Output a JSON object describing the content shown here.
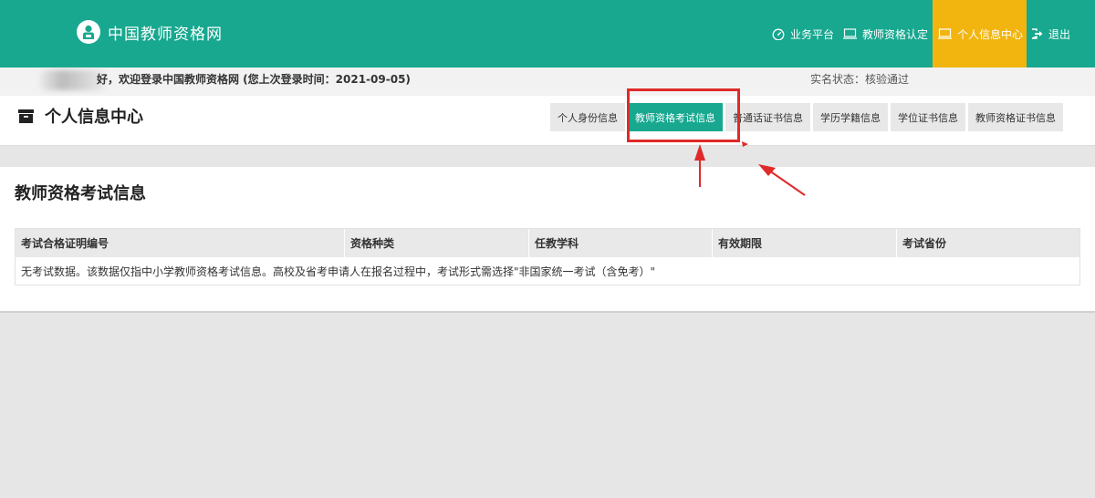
{
  "header": {
    "site_title": "中国教师资格网",
    "nav": [
      {
        "label": "业务平台",
        "icon": "dashboard-icon"
      },
      {
        "label": "教师资格认定",
        "icon": "monitor-icon"
      },
      {
        "label": "个人信息中心",
        "icon": "laptop-icon",
        "active": true
      },
      {
        "label": "退出",
        "icon": "logout-icon"
      }
    ]
  },
  "welcome": {
    "text": "好，欢迎登录中国教师资格网 (您上次登录时间：2021-09-05)",
    "realname_status": "实名状态：核验通过"
  },
  "center": {
    "title": "个人信息中心",
    "tabs": [
      {
        "label": "个人身份信息"
      },
      {
        "label": "教师资格考试信息",
        "active": true
      },
      {
        "label": "普通话证书信息"
      },
      {
        "label": "学历学籍信息"
      },
      {
        "label": "学位证书信息"
      },
      {
        "label": "教师资格证书信息"
      }
    ]
  },
  "exam_panel": {
    "title": "教师资格考试信息",
    "columns": [
      "考试合格证明编号",
      "资格种类",
      "任教学科",
      "有效期限",
      "考试省份"
    ],
    "empty_message": "无考试数据。该数据仅指中小学教师资格考试信息。高校及省考申请人在报名过程中，考试形式需选择\"非国家统一考试（含免考）\""
  },
  "colors": {
    "brand": "#17a88f",
    "active_nav": "#f2b50f",
    "annotation": "#e02a2a"
  }
}
